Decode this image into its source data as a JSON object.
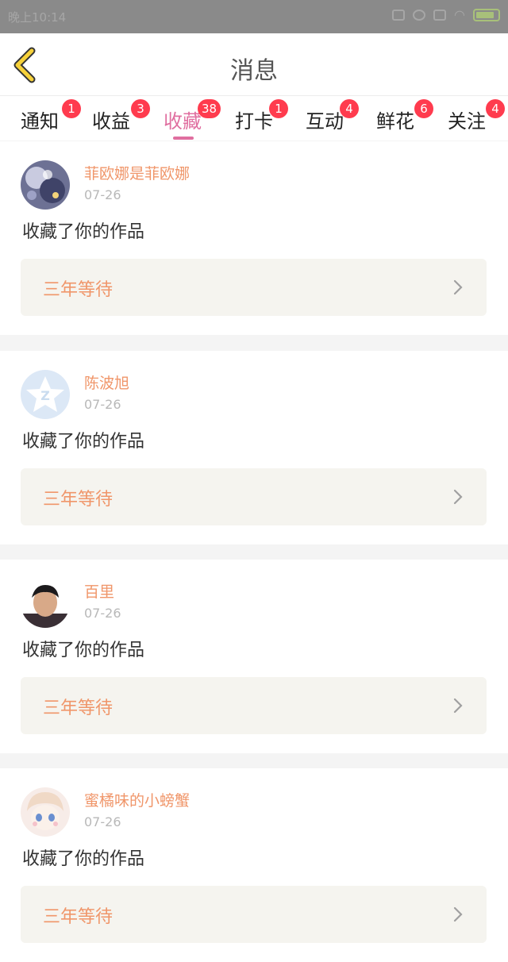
{
  "status_bar": {
    "time": "晚上10:14"
  },
  "nav": {
    "title": "消息"
  },
  "tabs": [
    {
      "label": "通知",
      "badge": "1"
    },
    {
      "label": "收益",
      "badge": "3"
    },
    {
      "label": "收藏",
      "badge": "38"
    },
    {
      "label": "打卡",
      "badge": "1"
    },
    {
      "label": "互动",
      "badge": "4"
    },
    {
      "label": "鲜花",
      "badge": "6"
    },
    {
      "label": "关注",
      "badge": "4"
    }
  ],
  "active_tab": "收藏",
  "colors": {
    "accent": "#e06fa0",
    "username": "#f0966a",
    "badge": "#ff3b4e"
  },
  "messages": [
    {
      "username": "菲欧娜是菲欧娜",
      "date": "07-26",
      "action": "收藏了你的作品",
      "work": "三年等待"
    },
    {
      "username": "陈波旭",
      "date": "07-26",
      "action": "收藏了你的作品",
      "work": "三年等待"
    },
    {
      "username": "百里",
      "date": "07-26",
      "action": "收藏了你的作品",
      "work": "三年等待"
    },
    {
      "username": "蜜橘味的小螃蟹",
      "date": "07-26",
      "action": "收藏了你的作品",
      "work": "三年等待"
    }
  ]
}
